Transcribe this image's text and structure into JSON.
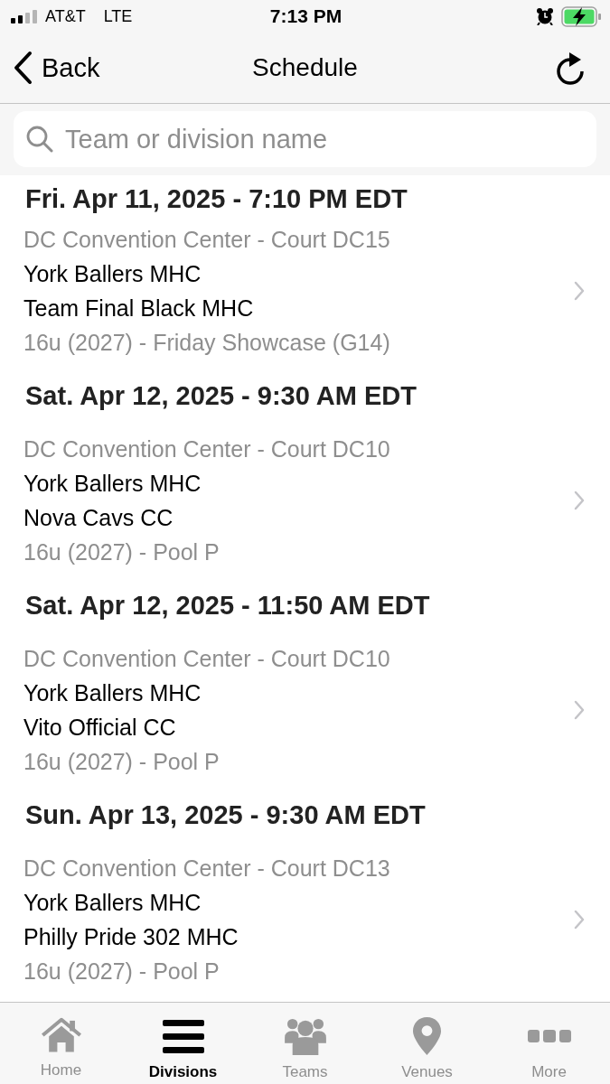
{
  "status_bar": {
    "carrier": "AT&T",
    "network": "LTE",
    "time": "7:13 PM"
  },
  "nav_bar": {
    "back_label": "Back",
    "title": "Schedule"
  },
  "search": {
    "placeholder": "Team or division name"
  },
  "games": [
    {
      "datetime": "Fri. Apr 11, 2025 - 7:10 PM EDT",
      "venue": "DC Convention Center - Court DC15",
      "teams": [
        "York Ballers MHC",
        "Team Final Black MHC"
      ],
      "division": "16u (2027) - Friday Showcase (G14)"
    },
    {
      "datetime": "Sat. Apr 12, 2025 - 9:30 AM EDT",
      "venue": "DC Convention Center - Court DC10",
      "teams": [
        "York Ballers MHC",
        "Nova Cavs CC"
      ],
      "division": "16u (2027) - Pool P"
    },
    {
      "datetime": "Sat. Apr 12, 2025 - 11:50 AM EDT",
      "venue": "DC Convention Center - Court DC10",
      "teams": [
        "York Ballers MHC",
        "Vito Official CC"
      ],
      "division": "16u (2027) - Pool P"
    },
    {
      "datetime": "Sun. Apr 13, 2025 - 9:30 AM EDT",
      "venue": "DC Convention Center - Court DC13",
      "teams": [
        "York Ballers MHC",
        "Philly Pride 302 MHC"
      ],
      "division": "16u (2027) - Pool P"
    }
  ],
  "tab_bar": [
    {
      "kind": "home",
      "label": "Home",
      "selected": false
    },
    {
      "kind": "divisions",
      "label": "Divisions",
      "selected": true
    },
    {
      "kind": "teams",
      "label": "Teams",
      "selected": false
    },
    {
      "kind": "venues",
      "label": "Venues",
      "selected": false
    },
    {
      "kind": "more",
      "label": "More",
      "selected": false
    }
  ]
}
